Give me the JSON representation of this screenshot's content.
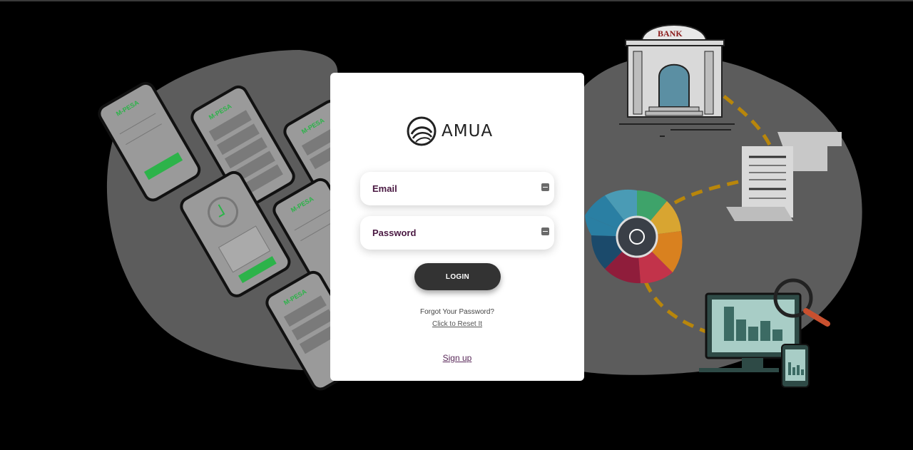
{
  "brand": {
    "name": "AMUA"
  },
  "login": {
    "email_placeholder": "Email",
    "password_placeholder": "Password",
    "login_button": "LOGIN",
    "forgot_text": "Forgot Your Password?",
    "reset_link": "Click to Reset It",
    "signup_link": "Sign up"
  },
  "illustration": {
    "bank_sign": "BANK",
    "phone_brand": "M-PESA"
  },
  "colors": {
    "page_background": "#000000",
    "card_background": "#ffffff",
    "button_background": "#333333",
    "label_color": "#4a1942",
    "mpesa_green": "#2db34a",
    "path_dashes": "#b8860b"
  }
}
